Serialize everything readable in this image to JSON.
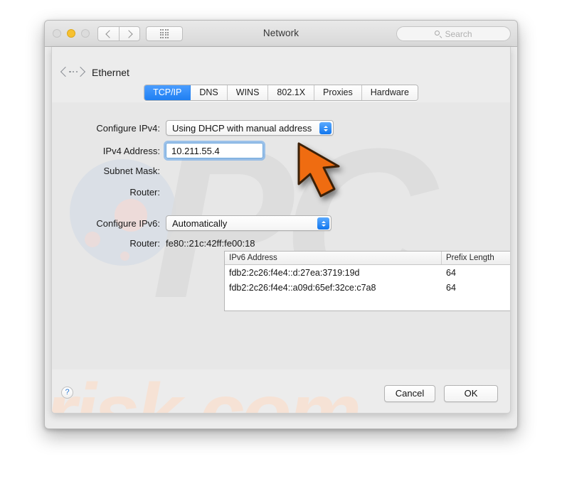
{
  "window": {
    "title": "Network",
    "traffic_lights": [
      "close",
      "minimize",
      "zoom"
    ],
    "toolbar": {
      "back_icon": "chevron-left-icon",
      "forward_icon": "chevron-right-icon",
      "show_all_icon": "grid-icon",
      "search_placeholder": "Search"
    }
  },
  "sheet": {
    "service": {
      "icon": "ethernet-icon",
      "name": "Ethernet"
    },
    "tabs": [
      {
        "label": "TCP/IP",
        "active": true
      },
      {
        "label": "DNS",
        "active": false
      },
      {
        "label": "WINS",
        "active": false
      },
      {
        "label": "802.1X",
        "active": false
      },
      {
        "label": "Proxies",
        "active": false
      },
      {
        "label": "Hardware",
        "active": false
      }
    ],
    "ipv4": {
      "configure_label": "Configure IPv4:",
      "configure_value": "Using DHCP with manual address",
      "address_label": "IPv4 Address:",
      "address_value": "10.211.55.4",
      "subnet_label": "Subnet Mask:",
      "subnet_value": "",
      "router_label": "Router:",
      "router_value": ""
    },
    "ipv6": {
      "configure_label": "Configure IPv6:",
      "configure_value": "Automatically",
      "router_label": "Router:",
      "router_value": "fe80::21c:42ff:fe00:18",
      "table": {
        "columns": [
          "IPv6 Address",
          "Prefix Length"
        ],
        "rows": [
          {
            "address": "fdb2:2c26:f4e4::d:27ea:3719:19d",
            "prefix": "64"
          },
          {
            "address": "fdb2:2c26:f4e4::a09d:65ef:32ce:c7a8",
            "prefix": "64"
          }
        ]
      }
    },
    "footer": {
      "help_label": "?",
      "cancel_label": "Cancel",
      "ok_label": "OK"
    }
  },
  "watermark": {
    "text": "risk.com",
    "mark": "PC"
  },
  "colors": {
    "accent_blue": "#1f7ff2",
    "cursor_orange": "#ef6c11",
    "minimize_yellow": "#f7c130",
    "focus_ring": "#5ca2eb"
  }
}
